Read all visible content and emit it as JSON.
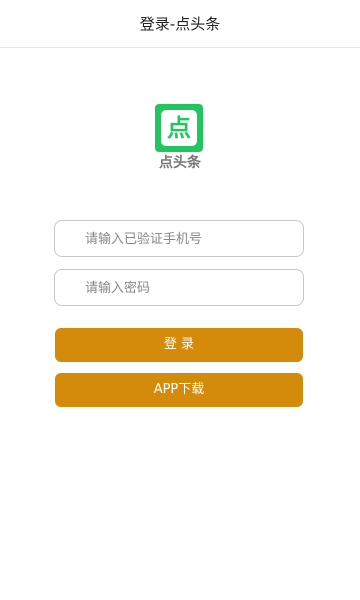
{
  "header": {
    "title": "登录-点头条"
  },
  "logo": {
    "icon_char": "点",
    "caption": "点头条",
    "color": "#22c55e"
  },
  "form": {
    "phone_placeholder": "请输入已验证手机号",
    "phone_value": "",
    "password_placeholder": "请输入密码",
    "password_value": ""
  },
  "buttons": {
    "login_label": "登 录",
    "download_label": "APP下载",
    "color": "#d48a0b"
  }
}
